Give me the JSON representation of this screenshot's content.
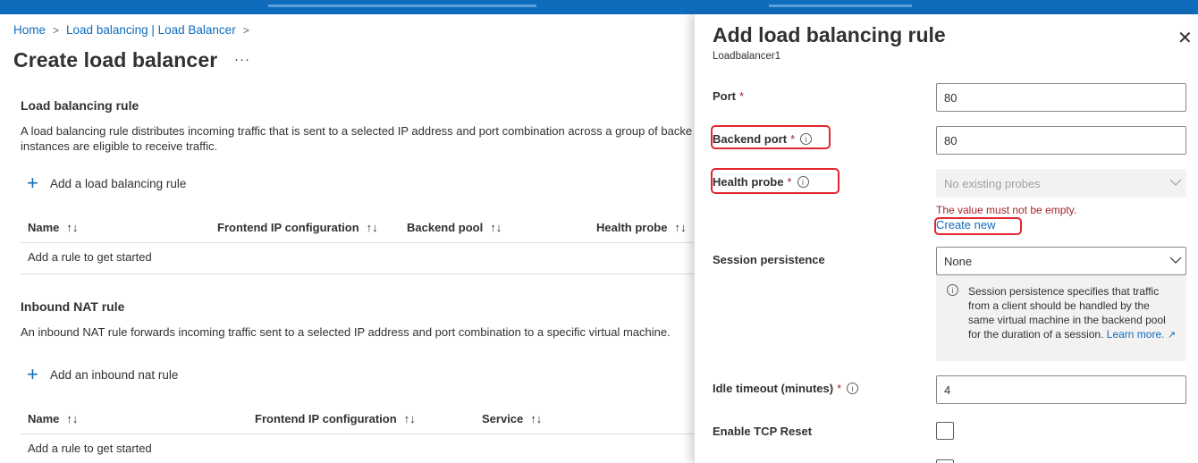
{
  "breadcrumb": {
    "home": "Home",
    "parent": "Load balancing | Load Balancer"
  },
  "page": {
    "title": "Create load balancer",
    "more": "···"
  },
  "lb_rules": {
    "title": "Load balancing rule",
    "description_line1": "A load balancing rule distributes incoming traffic that is sent to a selected IP address and port combination across a group of backe",
    "description_line2": "instances are eligible to receive traffic.",
    "add_label": "Add a load balancing rule",
    "columns": [
      "Name",
      "Frontend IP configuration",
      "Backend pool",
      "Health probe"
    ],
    "empty_text": "Add a rule to get started"
  },
  "nat_rules": {
    "title": "Inbound NAT rule",
    "description": "An inbound NAT rule forwards incoming traffic sent to a selected IP address and port combination to a specific virtual machine.",
    "add_label": "Add an inbound nat rule",
    "columns": [
      "Name",
      "Frontend IP configuration",
      "Service"
    ],
    "empty_text": "Add a rule to get started"
  },
  "sort_glyph": "↑↓",
  "panel": {
    "title": "Add load balancing rule",
    "subtitle": "Loadbalancer1",
    "close": "✕",
    "port": {
      "label": "Port",
      "value": "80"
    },
    "backend_port": {
      "label": "Backend port",
      "value": "80"
    },
    "health_probe": {
      "label": "Health probe",
      "placeholder": "No existing probes",
      "error": "The value must not be empty.",
      "create_new": "Create new"
    },
    "session_persistence": {
      "label": "Session persistence",
      "value": "None",
      "info_text": "Session persistence specifies that traffic from a client should be handled by the same virtual machine in the backend pool for the duration of a session.",
      "learn_more": "Learn more."
    },
    "idle_timeout": {
      "label": "Idle timeout (minutes)",
      "value": "4"
    },
    "tcp_reset": {
      "label": "Enable TCP Reset"
    },
    "required_mark": "*",
    "info_glyph": "i"
  },
  "colors": {
    "accent": "#0f6cbd",
    "error": "#a4262c",
    "highlight_box": "#e3262f"
  }
}
